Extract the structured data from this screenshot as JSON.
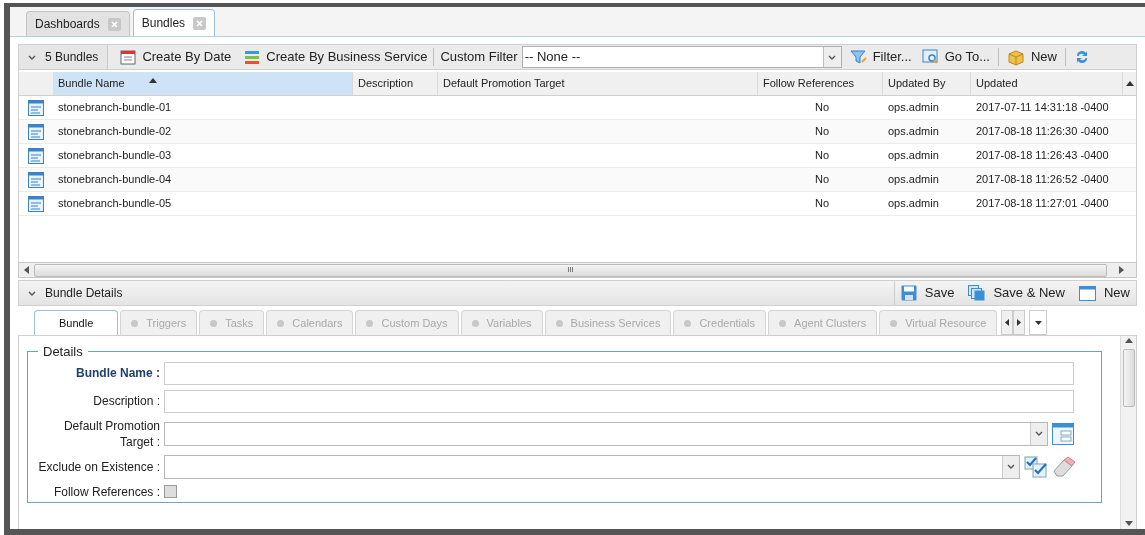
{
  "tabs": [
    {
      "label": "Dashboards",
      "selected": false
    },
    {
      "label": "Bundles",
      "selected": true
    }
  ],
  "toolbar": {
    "collapse_label": "5 Bundles",
    "create_by_date": "Create By Date",
    "create_by_service": "Create By Business Service",
    "custom_filter": {
      "label": "Custom Filter",
      "value": "-- None --"
    },
    "filter": "Filter...",
    "go_to": "Go To...",
    "new": "New"
  },
  "table": {
    "columns": [
      {
        "label": "Bundle Name",
        "sorted": true
      },
      {
        "label": "Description",
        "sorted": false
      },
      {
        "label": "Default Promotion Target",
        "sorted": false
      },
      {
        "label": "Follow References",
        "sorted": false
      },
      {
        "label": "Updated By",
        "sorted": false
      },
      {
        "label": "Updated",
        "sorted": false
      }
    ],
    "rows": [
      {
        "cells": [
          "stonebranch-bundle-01",
          "",
          "",
          "No",
          "ops.admin",
          "2017-07-11 14:31:18 -0400"
        ]
      },
      {
        "cells": [
          "stonebranch-bundle-02",
          "",
          "",
          "No",
          "ops.admin",
          "2017-08-18 11:26:30 -0400"
        ]
      },
      {
        "cells": [
          "stonebranch-bundle-03",
          "",
          "",
          "No",
          "ops.admin",
          "2017-08-18 11:26:43 -0400"
        ]
      },
      {
        "cells": [
          "stonebranch-bundle-04",
          "",
          "",
          "No",
          "ops.admin",
          "2017-08-18 11:26:52 -0400"
        ]
      },
      {
        "cells": [
          "stonebranch-bundle-05",
          "",
          "",
          "No",
          "ops.admin",
          "2017-08-18 11:27:01 -0400"
        ]
      }
    ],
    "scroll_grip": "III"
  },
  "details": {
    "title": "Bundle Details",
    "actions": [
      {
        "kind": "save",
        "label": "Save"
      },
      {
        "kind": "save_new",
        "label": "Save & New"
      },
      {
        "kind": "new",
        "label": "New"
      }
    ],
    "tabs": [
      {
        "label": "Bundle",
        "selected": true,
        "disabled": false
      },
      {
        "label": "Triggers",
        "selected": false,
        "disabled": true
      },
      {
        "label": "Tasks",
        "selected": false,
        "disabled": true
      },
      {
        "label": "Calendars",
        "selected": false,
        "disabled": true
      },
      {
        "label": "Custom Days",
        "selected": false,
        "disabled": true
      },
      {
        "label": "Variables",
        "selected": false,
        "disabled": true
      },
      {
        "label": "Business Services",
        "selected": false,
        "disabled": true
      },
      {
        "label": "Credentials",
        "selected": false,
        "disabled": true
      },
      {
        "label": "Agent Clusters",
        "selected": false,
        "disabled": true
      },
      {
        "label": "Virtual Resource",
        "selected": false,
        "disabled": true
      }
    ],
    "legend": "Details",
    "fields": [
      {
        "kind": "text",
        "label": "Bundle Name :",
        "required": true
      },
      {
        "kind": "text",
        "label": "Description :",
        "required": false
      },
      {
        "kind": "select_details",
        "label": "Default Promotion Target :",
        "required": false
      },
      {
        "kind": "select_multi",
        "label": "Exclude on Existence :",
        "required": false
      },
      {
        "kind": "checkbox",
        "label": "Follow References :",
        "required": false,
        "checked": false
      }
    ]
  }
}
